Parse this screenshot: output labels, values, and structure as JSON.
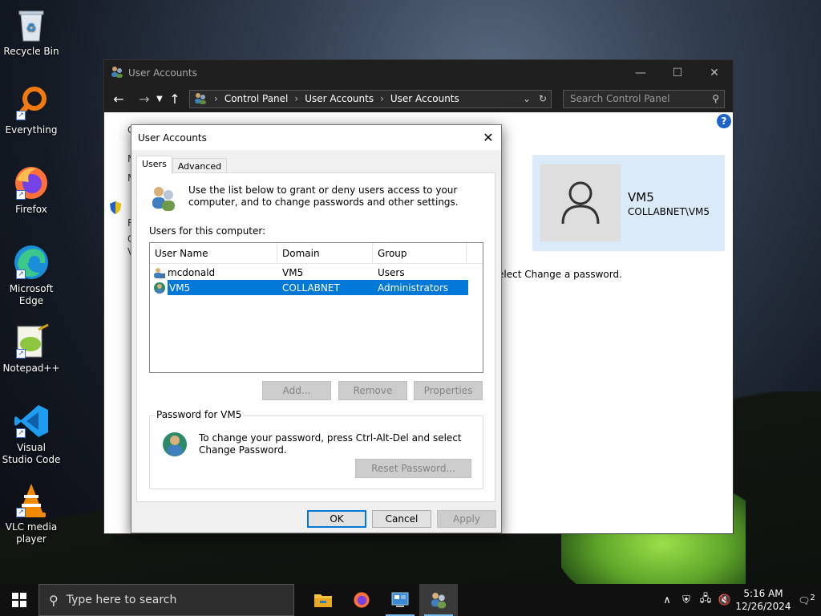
{
  "desktop": {
    "icons": [
      {
        "label": "Recycle Bin",
        "icon": "recycle-bin-icon"
      },
      {
        "label": "Everything",
        "icon": "everything-search-icon"
      },
      {
        "label": "Firefox",
        "icon": "firefox-icon"
      },
      {
        "label": "Microsoft Edge",
        "icon": "edge-icon"
      },
      {
        "label": "Notepad++",
        "icon": "notepadpp-icon"
      },
      {
        "label": "Visual Studio Code",
        "icon": "vscode-icon"
      },
      {
        "label": "VLC media player",
        "icon": "vlc-icon"
      }
    ]
  },
  "control_panel": {
    "title": "User Accounts",
    "breadcrumb": [
      "Control Panel",
      "User Accounts",
      "User Accounts"
    ],
    "search_placeholder": "Search Control Panel",
    "left_letters": [
      "C",
      "M",
      "M",
      "R",
      "C",
      "V"
    ],
    "user_card": {
      "name": "VM5",
      "domain": "COLLABNET\\VM5"
    },
    "snippet": "elect Change a password."
  },
  "dialog": {
    "title": "User Accounts",
    "tabs": [
      "Users",
      "Advanced"
    ],
    "intro": "Use the list below to grant or deny users access to your computer, and to change passwords and other settings.",
    "list_label": "Users for this computer:",
    "columns": [
      "User Name",
      "Domain",
      "Group"
    ],
    "rows": [
      {
        "user": "mcdonald",
        "domain": "VM5",
        "group": "Users",
        "selected": false
      },
      {
        "user": "VM5",
        "domain": "COLLABNET",
        "group": "Administrators",
        "selected": true
      }
    ],
    "buttons": {
      "add": "Add...",
      "remove": "Remove",
      "properties": "Properties"
    },
    "password_group": {
      "legend": "Password for VM5",
      "text": "To change your password, press Ctrl-Alt-Del and select Change Password.",
      "reset": "Reset Password..."
    },
    "footer": {
      "ok": "OK",
      "cancel": "Cancel",
      "apply": "Apply"
    }
  },
  "taskbar": {
    "search_placeholder": "Type here to search",
    "time": "5:16 AM",
    "date": "12/26/2024",
    "notification_count": "2"
  }
}
